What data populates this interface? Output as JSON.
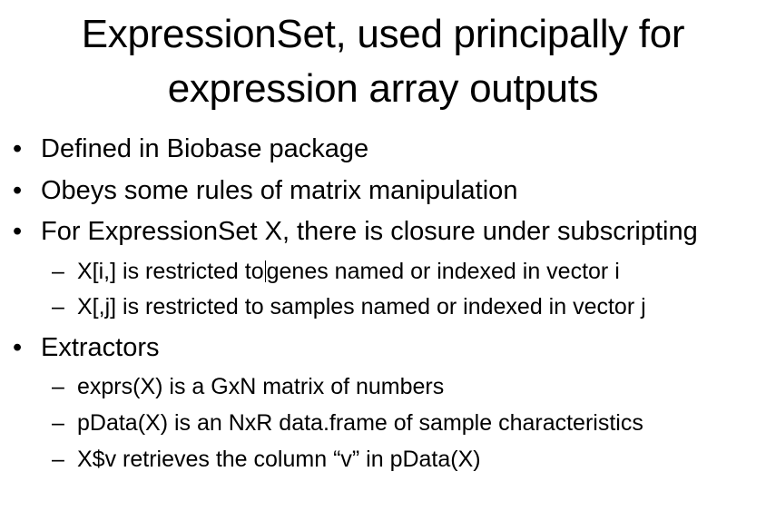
{
  "slide": {
    "title_lines": [
      "ExpressionSet, used principally for",
      "expression array outputs"
    ],
    "bullet_glyph": "•",
    "dash_glyph": "–",
    "bullets": [
      {
        "text": "Defined in Biobase package"
      },
      {
        "text": "Obeys some rules of matrix manipulation"
      },
      {
        "text": "For ExpressionSet X, there is closure under subscripting",
        "sub": [
          {
            "text_before_cursor": "X[i,] is restricted to",
            "text_after_cursor": "genes named or indexed in vector i"
          },
          {
            "text": "X[,j] is restricted to samples named or indexed in vector j"
          }
        ]
      },
      {
        "text": "Extractors",
        "sub": [
          {
            "text": "exprs(X) is a GxN matrix of numbers"
          },
          {
            "text": "pData(X) is an NxR data.frame of sample characteristics"
          },
          {
            "text": "X$v retrieves the column “v” in pData(X)"
          }
        ]
      }
    ]
  }
}
